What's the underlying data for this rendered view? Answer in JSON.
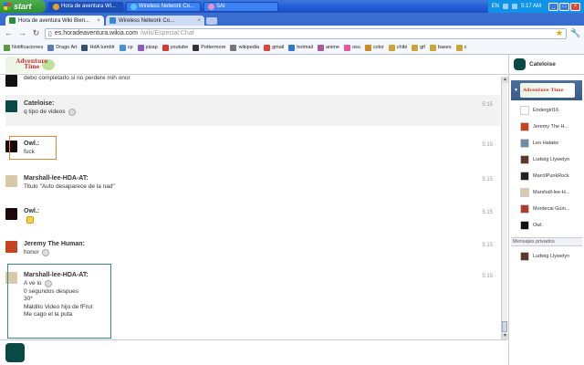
{
  "taskbar": {
    "start_label": "start",
    "tasks": [
      {
        "label": "Hora de aventura Wi...",
        "color": "#e8a02f",
        "active": true
      },
      {
        "label": "Wireless Network Co...",
        "color": "#59c2f0",
        "active": false
      },
      {
        "label": "SAI",
        "color": "#f08cc8",
        "active": false
      }
    ],
    "language": "EN",
    "clock": "5:17 AM"
  },
  "browser": {
    "tabs": [
      {
        "label": "Hora de aventura Wiki Bien...",
        "icon_color": "#2b8c3a",
        "active": true
      },
      {
        "label": "Wireless Network Co...",
        "icon_color": "#3a86d8",
        "active": false
      }
    ],
    "url": {
      "host": "es.horadeaventura.wikia.com",
      "path": "/wiki/Especial:Chat"
    },
    "bookmarks": [
      {
        "label": "Notificaciones",
        "color": "#5a9a3c"
      },
      {
        "label": "Drago Art",
        "color": "#5a7fb8"
      },
      {
        "label": "HdA tumblr",
        "color": "#34526f"
      },
      {
        "label": "cp",
        "color": "#4a90d9"
      },
      {
        "label": "pizap",
        "color": "#8d5bbd"
      },
      {
        "label": "youtube",
        "color": "#d63a2f"
      },
      {
        "label": "Pottermore",
        "color": "#333333"
      },
      {
        "label": "wikipedia",
        "color": "#777777"
      },
      {
        "label": "gmail",
        "color": "#d9463a"
      },
      {
        "label": "hotmail",
        "color": "#2f79c9"
      },
      {
        "label": "anime",
        "color": "#a85a9a"
      },
      {
        "label": "osu",
        "color": "#e8559b"
      },
      {
        "label": "color",
        "color": "#c98e2a"
      },
      {
        "label": "chibi",
        "color": "#c9a63a"
      },
      {
        "label": "gif",
        "color": "#c9a63a"
      },
      {
        "label": "bases",
        "color": "#c9a63a"
      },
      {
        "label": "c",
        "color": "#c9a63a"
      }
    ]
  },
  "chat": {
    "logo_text": "Adventure Time",
    "messages": [
      {
        "who": "",
        "lines": [
          "debo completarlo si no perdere mih onor"
        ],
        "time": "",
        "avatar_color": "#111111",
        "shaded": false,
        "emote": ""
      },
      {
        "who": "Cateloise:",
        "lines": [
          "q tipo de videos"
        ],
        "time": "5:15",
        "avatar_color": "#0a4a45",
        "shaded": true,
        "emote": "grey"
      },
      {
        "who": "Owl.:",
        "lines": [
          "fuck"
        ],
        "time": "5:15",
        "avatar_color": "#1a0a0a",
        "shaded": false,
        "emote": ""
      },
      {
        "who": "Marshall-lee-HDA-AT:",
        "lines": [
          "Titulo \"Auto desaparece de la nad\""
        ],
        "time": "5:15",
        "avatar_color": "#d9c9a8",
        "shaded": false,
        "emote": ""
      },
      {
        "who": "Owl.:",
        "lines": [
          ""
        ],
        "time": "5:15",
        "avatar_color": "#1a0a0a",
        "shaded": false,
        "emote": "yellow"
      },
      {
        "who": "Jeremy The Human:",
        "lines": [
          "honor"
        ],
        "time": "5:15",
        "avatar_color": "#c8421f",
        "shaded": false,
        "emote": "grey"
      },
      {
        "who": "Marshall-lee-HDA-AT:",
        "lines": [
          "A ve lo",
          "0 segundos despues",
          "30*",
          "Maldito Video hijo de fFrut",
          "Me cago el la puta"
        ],
        "time": "5:15",
        "avatar_color": "#d9c9a8",
        "shaded": false,
        "emote": "grey"
      }
    ],
    "input_value": ""
  },
  "rail": {
    "me": "Cateloise",
    "room_logo_text": "Adventure Time",
    "users": [
      {
        "name": "Endergirl16",
        "color": "#ffffff"
      },
      {
        "name": "Jeremy The H...",
        "color": "#c8421f"
      },
      {
        "name": "Leo Hatake",
        "color": "#6b8fa8"
      },
      {
        "name": "Ludwig Llywelyn",
        "color": "#5a3a2a"
      },
      {
        "name": "MarcilPunkRock",
        "color": "#222222"
      },
      {
        "name": "Marshall-lee-H...",
        "color": "#d9c9a8"
      },
      {
        "name": "Mordecai Guin...",
        "color": "#b03a2e"
      },
      {
        "name": "Owl.",
        "color": "#111111"
      }
    ],
    "private_header": "Mensajes privados",
    "private_users": [
      {
        "name": "Ludwig Llywelyn",
        "color": "#5a3a2a"
      }
    ]
  },
  "colors": {
    "highlight_orange": "#e08a3a",
    "highlight_teal": "#3a8a86"
  }
}
